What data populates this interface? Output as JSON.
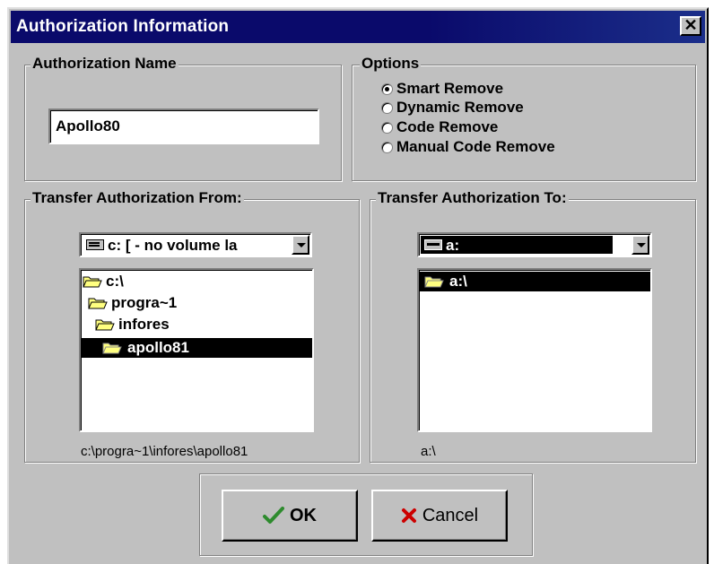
{
  "window": {
    "title": "Authorization Information",
    "close_glyph": "✕"
  },
  "auth_name": {
    "legend": "Authorization Name",
    "value": "Apollo80"
  },
  "options": {
    "legend": "Options",
    "items": [
      {
        "label": "Smart Remove",
        "checked": true
      },
      {
        "label": "Dynamic Remove",
        "checked": false
      },
      {
        "label": "Code Remove",
        "checked": false
      },
      {
        "label": "Manual Code Remove",
        "checked": false
      }
    ]
  },
  "transfer_from": {
    "legend": "Transfer Authorization From:",
    "drive": "c: [ - no volume la",
    "dirs": [
      {
        "label": "c:\\",
        "selected": false
      },
      {
        "label": "progra~1",
        "selected": false
      },
      {
        "label": "infores",
        "selected": false
      },
      {
        "label": "apollo81",
        "selected": true
      }
    ],
    "path": "c:\\progra~1\\infores\\apollo81"
  },
  "transfer_to": {
    "legend": "Transfer Authorization To:",
    "drive": "a:",
    "dirs": [
      {
        "label": "a:\\",
        "selected": true
      }
    ],
    "path": "a:\\"
  },
  "buttons": {
    "ok": "OK",
    "cancel": "Cancel"
  },
  "icons": {
    "drive_icon": "hard-drive-icon",
    "floppy_icon": "floppy-drive-icon",
    "folder": "folder-icon",
    "open_folder": "folder-open-icon",
    "ok_icon": "checkmark-icon",
    "cancel_icon": "x-mark-icon"
  },
  "colors": {
    "titlebar": "#0a0a6b",
    "face": "#c0c0c0",
    "ok_check": "#2e8b2e",
    "cancel_x": "#cc0000"
  }
}
